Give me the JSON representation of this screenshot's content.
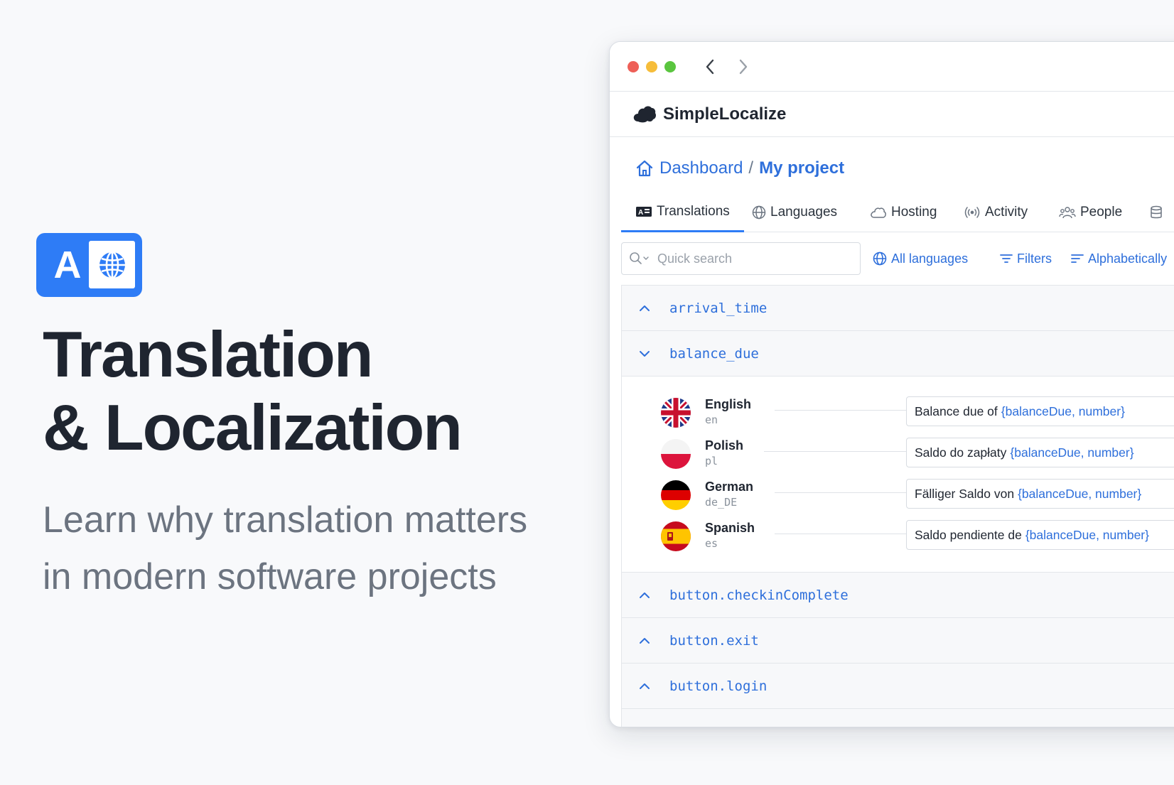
{
  "hero": {
    "title_line1": "Translation",
    "title_line2": "& Localization",
    "subtitle_line1": "Learn why translation matters",
    "subtitle_line2": "in modern software projects",
    "logo_letter": "A",
    "brand_color": "#2e7cf6"
  },
  "app": {
    "name": "SimpleLocalize",
    "breadcrumb": {
      "home": "Dashboard",
      "separator": "/",
      "current": "My project"
    },
    "tabs": [
      {
        "label": "Translations",
        "icon": "id-card-icon",
        "active": true
      },
      {
        "label": "Languages",
        "icon": "globe-icon",
        "active": false
      },
      {
        "label": "Hosting",
        "icon": "cloud-icon",
        "active": false
      },
      {
        "label": "Activity",
        "icon": "broadcast-icon",
        "active": false
      },
      {
        "label": "People",
        "icon": "people-icon",
        "active": false
      }
    ],
    "toolbar": {
      "search_placeholder": "Quick search",
      "languages_label": "All languages",
      "filters_label": "Filters",
      "sort_label": "Alphabetically"
    },
    "keys": [
      {
        "key": "arrival_time",
        "expanded": false
      },
      {
        "key": "balance_due",
        "expanded": true
      },
      {
        "key": "button.checkinComplete",
        "expanded": false
      },
      {
        "key": "button.exit",
        "expanded": false
      },
      {
        "key": "button.login",
        "expanded": false
      }
    ],
    "translations": [
      {
        "language": "English",
        "code": "en",
        "text": "Balance due of",
        "placeholder": "{balanceDue, number}"
      },
      {
        "language": "Polish",
        "code": "pl",
        "text": "Saldo do zapłaty",
        "placeholder": "{balanceDue, number}"
      },
      {
        "language": "German",
        "code": "de_DE",
        "text": "Fälliger Saldo von",
        "placeholder": "{balanceDue, number}"
      },
      {
        "language": "Spanish",
        "code": "es",
        "text": "Saldo pendiente de",
        "placeholder": "{balanceDue, number}"
      }
    ],
    "link_color": "#2e6fdb"
  }
}
